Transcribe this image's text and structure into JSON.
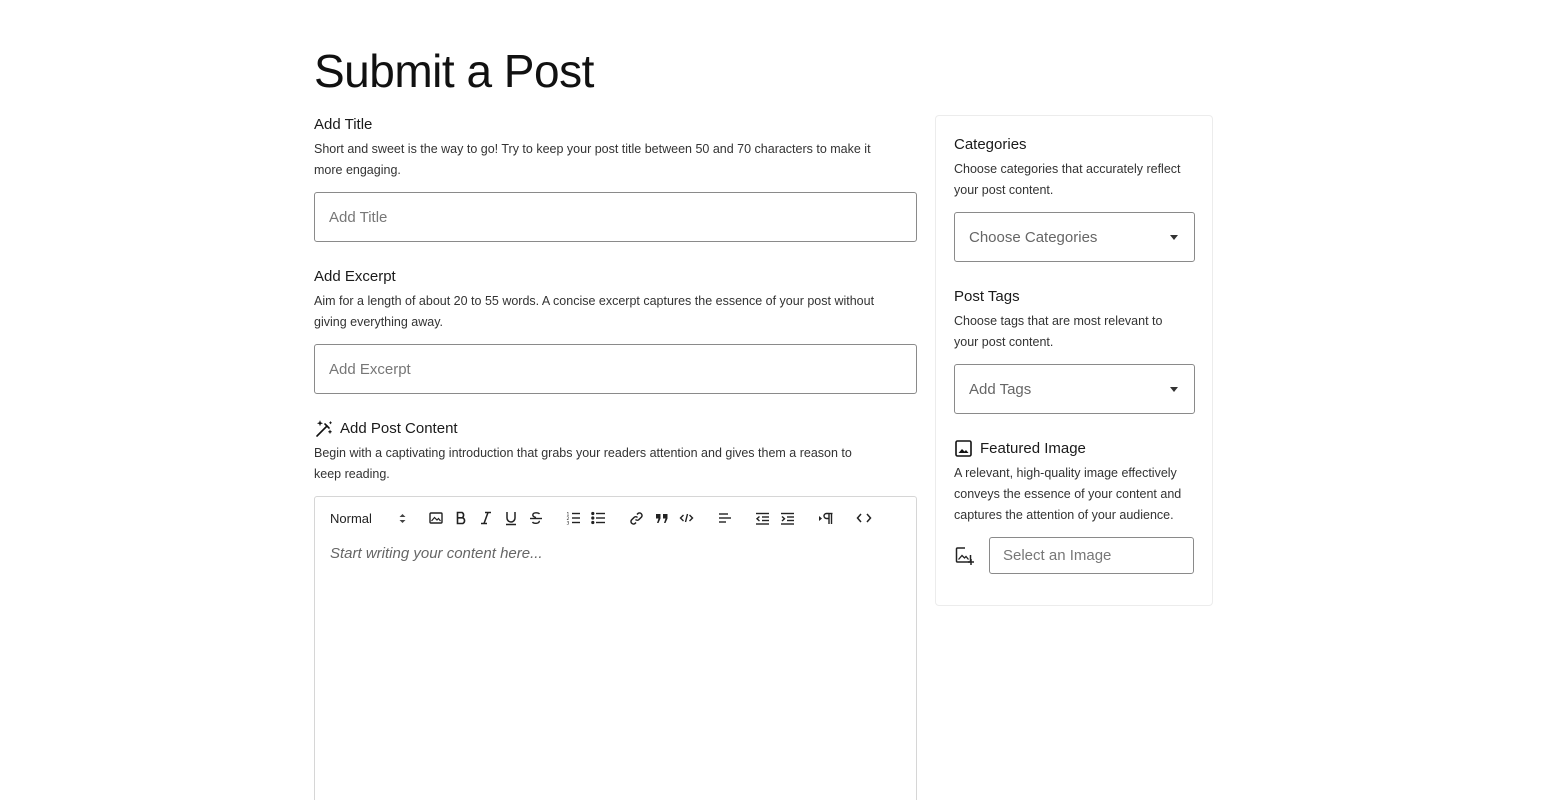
{
  "page": {
    "title": "Submit a Post"
  },
  "title_field": {
    "label": "Add Title",
    "description": "Short and sweet is the way to go! Try to keep your post title between 50 and 70 characters to make it more engaging.",
    "placeholder": "Add Title",
    "value": ""
  },
  "excerpt_field": {
    "label": "Add Excerpt",
    "description": "Aim for a length of about 20 to 55 words. A concise excerpt captures the essence of your post without giving everything away.",
    "placeholder": "Add Excerpt",
    "value": ""
  },
  "content_field": {
    "label": "Add Post Content",
    "icon": "magic-wand-icon",
    "description": "Begin with a captivating introduction that grabs your readers attention and gives them a reason to keep reading.",
    "placeholder": "Start writing your content here...",
    "toolbar": {
      "format_select": "Normal",
      "buttons": [
        "image",
        "bold",
        "italic",
        "underline",
        "strike",
        "ordered-list",
        "bullet-list",
        "link",
        "blockquote",
        "code-block",
        "align",
        "outdent",
        "indent",
        "text-direction",
        "code-view"
      ]
    }
  },
  "sidebar": {
    "categories": {
      "label": "Categories",
      "description": "Choose categories that accurately reflect your post content.",
      "placeholder": "Choose Categories"
    },
    "tags": {
      "label": "Post Tags",
      "description": "Choose tags that are most relevant to your post content.",
      "placeholder": "Add Tags"
    },
    "featured_image": {
      "label": "Featured Image",
      "icon": "image-icon",
      "description": "A relevant, high-quality image effectively conveys the essence of your content and captures the attention of your audience.",
      "placeholder": "Select an Image"
    }
  }
}
